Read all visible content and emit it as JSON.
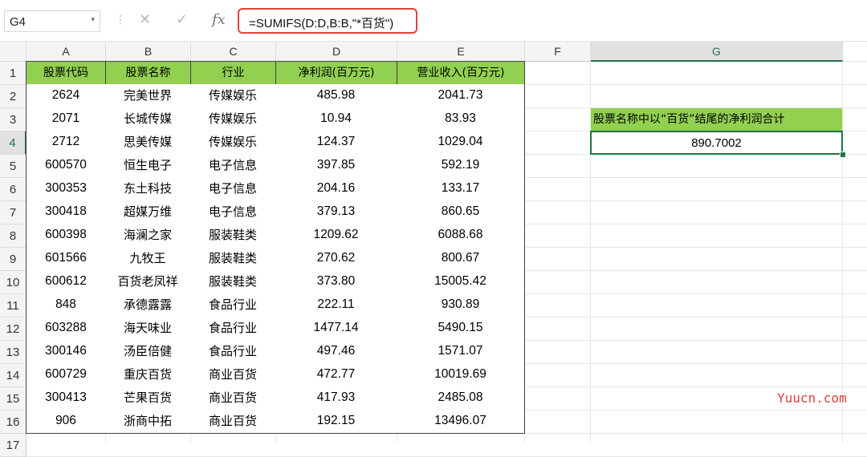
{
  "name_box": "G4",
  "formula": "=SUMIFS(D:D,B:B,\"*百货\")",
  "columns": [
    "A",
    "B",
    "C",
    "D",
    "E",
    "F",
    "G"
  ],
  "rows": [
    "1",
    "2",
    "3",
    "4",
    "5",
    "6",
    "7",
    "8",
    "9",
    "10",
    "11",
    "12",
    "13",
    "14",
    "15",
    "16",
    "17"
  ],
  "headers": [
    "股票代码",
    "股票名称",
    "行业",
    "净利润(百万元)",
    "营业收入(百万元)"
  ],
  "table": [
    [
      "2624",
      "完美世界",
      "传媒娱乐",
      "485.98",
      "2041.73"
    ],
    [
      "2071",
      "长城传媒",
      "传媒娱乐",
      "10.94",
      "83.93"
    ],
    [
      "2712",
      "思美传媒",
      "传媒娱乐",
      "124.37",
      "1029.04"
    ],
    [
      "600570",
      "恒生电子",
      "电子信息",
      "397.85",
      "592.19"
    ],
    [
      "300353",
      "东土科技",
      "电子信息",
      "204.16",
      "133.17"
    ],
    [
      "300418",
      "超媒万维",
      "电子信息",
      "379.13",
      "860.65"
    ],
    [
      "600398",
      "海澜之家",
      "服装鞋类",
      "1209.62",
      "6088.68"
    ],
    [
      "601566",
      "九牧王",
      "服装鞋类",
      "270.62",
      "800.67"
    ],
    [
      "600612",
      "百货老凤祥",
      "服装鞋类",
      "373.80",
      "15005.42"
    ],
    [
      "848",
      "承德露露",
      "食品行业",
      "222.11",
      "930.89"
    ],
    [
      "603288",
      "海天味业",
      "食品行业",
      "1477.14",
      "5490.15"
    ],
    [
      "300146",
      "汤臣倍健",
      "食品行业",
      "497.46",
      "1571.07"
    ],
    [
      "600729",
      "重庆百货",
      "商业百货",
      "472.77",
      "10019.69"
    ],
    [
      "300413",
      "芒果百货",
      "商业百货",
      "417.93",
      "2485.08"
    ],
    [
      "906",
      "浙商中拓",
      "商业百货",
      "192.15",
      "13496.07"
    ]
  ],
  "summary": {
    "label": "股票名称中以“百货”结尾的净利润合计",
    "value": "890.7002"
  },
  "watermark": "Yuucn.com",
  "colors": {
    "header_fill": "#92d050",
    "selection": "#217346",
    "formula_highlight": "#e0413a"
  }
}
